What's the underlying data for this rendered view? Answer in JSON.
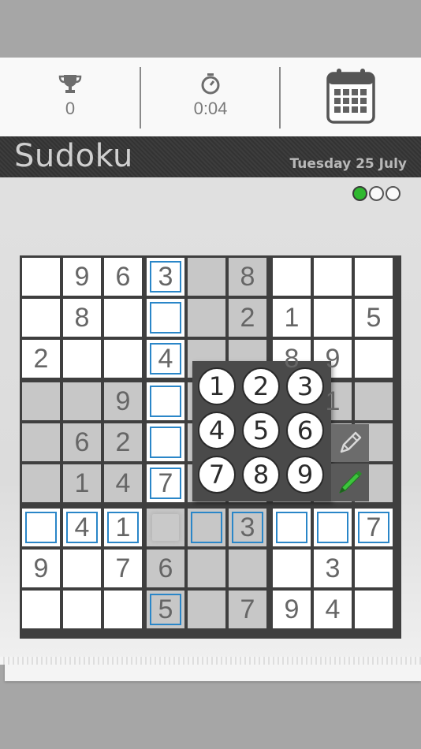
{
  "header": {
    "trophy_count": "0",
    "timer": "0:04"
  },
  "title": "Sudoku",
  "date": "Tuesday 25 July",
  "progress": {
    "completed": 1,
    "total": 3
  },
  "colors": {
    "accent_blue": "#2a86c8",
    "progress_green": "#2fb82f",
    "pen_green": "#3cc43c"
  },
  "board": {
    "rows": [
      [
        "",
        "9",
        "6",
        "3",
        "",
        "8",
        "",
        "",
        ""
      ],
      [
        "",
        "8",
        "",
        "",
        "",
        "2",
        "1",
        "",
        "5"
      ],
      [
        "2",
        "",
        "",
        "4",
        "",
        "",
        "8",
        "9",
        ""
      ],
      [
        "",
        "",
        "9",
        "",
        "",
        "",
        "",
        "1",
        ""
      ],
      [
        "",
        "6",
        "2",
        "",
        "",
        "",
        "",
        "",
        ""
      ],
      [
        "",
        "1",
        "4",
        "7",
        "",
        "",
        "",
        "",
        ""
      ],
      [
        "",
        "4",
        "1",
        "",
        "",
        "3",
        "",
        "",
        "7"
      ],
      [
        "9",
        "",
        "7",
        "6",
        "",
        "",
        "",
        "3",
        ""
      ],
      [
        "",
        "",
        "",
        "5",
        "",
        "7",
        "9",
        "4",
        ""
      ]
    ],
    "selected": {
      "row": 7,
      "col": 4
    }
  },
  "picker": {
    "numbers": [
      "1",
      "2",
      "3",
      "4",
      "5",
      "6",
      "7",
      "8",
      "9"
    ],
    "pencil_icon": "pencil-icon",
    "pen_icon": "pen-icon"
  }
}
